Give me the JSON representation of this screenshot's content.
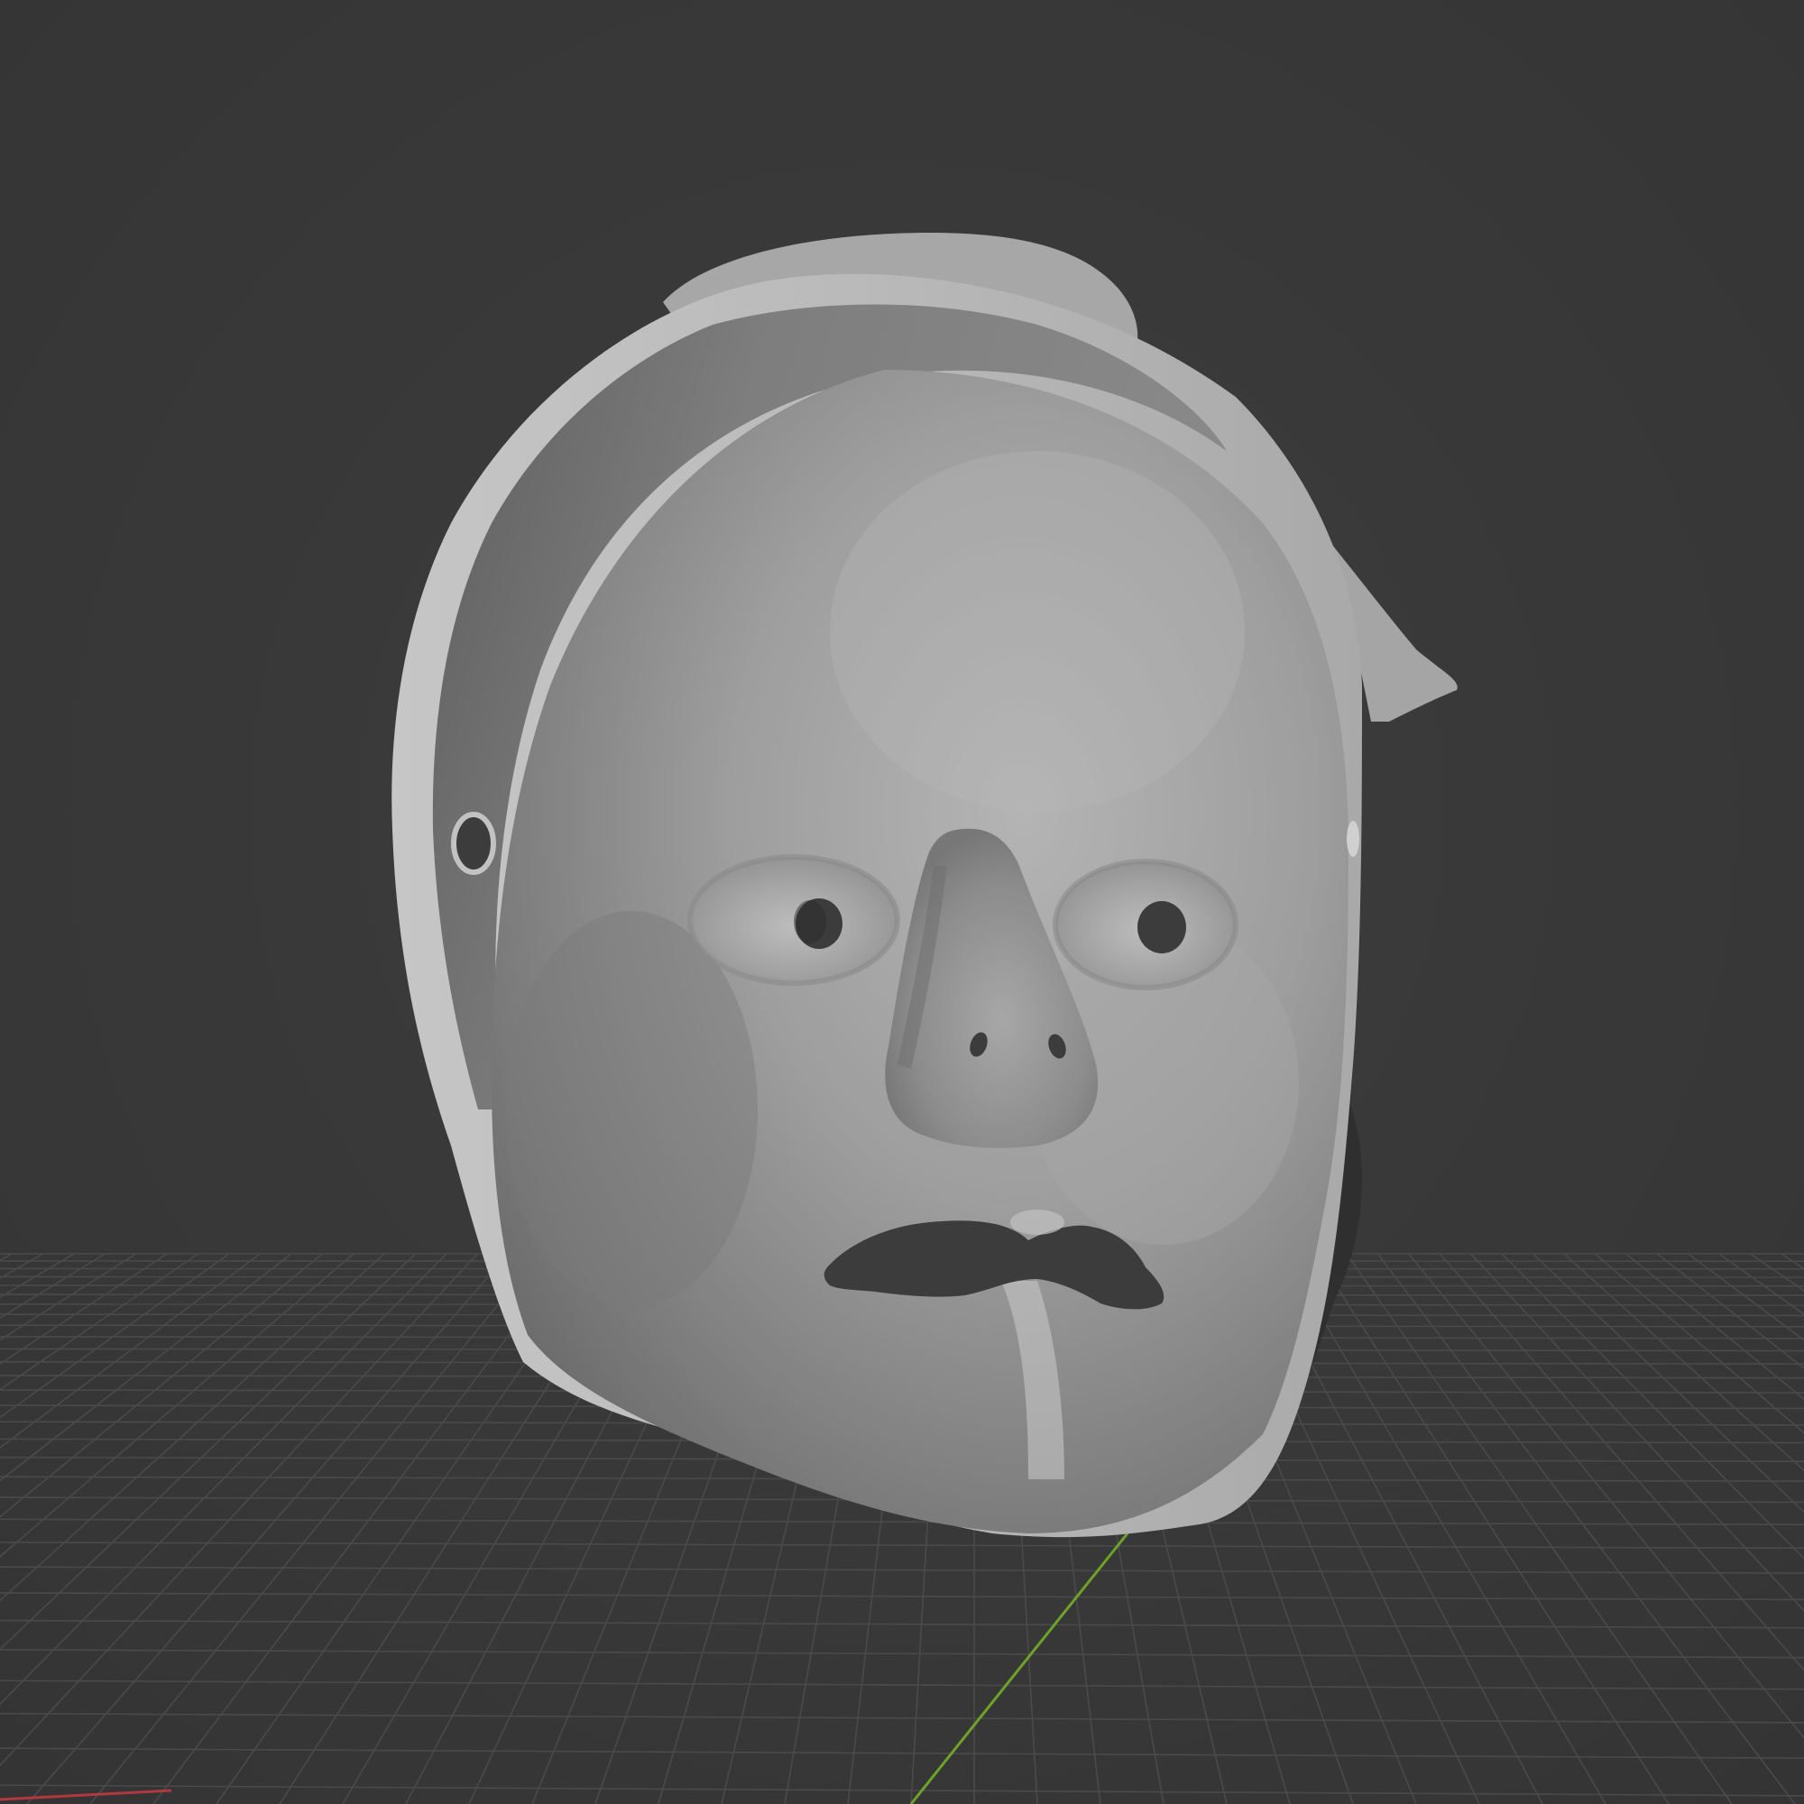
{
  "viewport": {
    "background_color": "#3a3a3a",
    "grid_line_color": "#4a4a4a",
    "x_axis_color": "#b0383f",
    "y_axis_color": "#6ea328",
    "model_color": "#a8a8a8",
    "hole_color": "#3c3c3c"
  },
  "model": {
    "type": "face-mask",
    "features": [
      "nose",
      "left-eye-hole",
      "right-eye-hole",
      "nostrils",
      "mouth-opening",
      "strap-holes",
      "rim"
    ]
  }
}
